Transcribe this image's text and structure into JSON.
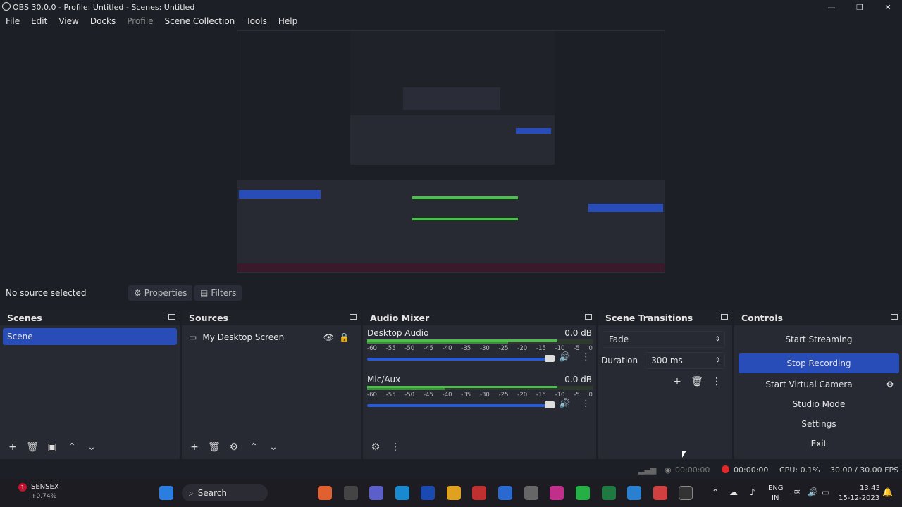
{
  "window": {
    "title": "OBS 30.0.0 - Profile: Untitled - Scenes: Untitled",
    "minimize": "—",
    "maximize": "❐",
    "close": "✕"
  },
  "menu": [
    "File",
    "Edit",
    "View",
    "Docks",
    "Profile",
    "Scene Collection",
    "Tools",
    "Help"
  ],
  "source_bar": {
    "no_source": "No source selected",
    "properties": "Properties",
    "filters": "Filters"
  },
  "scenes": {
    "title": "Scenes",
    "items": [
      "Scene"
    ]
  },
  "sources": {
    "title": "Sources",
    "items": [
      "My Desktop Screen"
    ]
  },
  "mixer": {
    "title": "Audio Mixer",
    "channels": [
      {
        "name": "Desktop Audio",
        "db": "0.0 dB"
      },
      {
        "name": "Mic/Aux",
        "db": "0.0 dB"
      }
    ],
    "ticks": [
      "-60",
      "-55",
      "-50",
      "-45",
      "-40",
      "-35",
      "-30",
      "-25",
      "-20",
      "-15",
      "-10",
      "-5",
      "0"
    ]
  },
  "transitions": {
    "title": "Scene Transitions",
    "selected": "Fade",
    "duration_label": "Duration",
    "duration_value": "300 ms"
  },
  "controls": {
    "title": "Controls",
    "start_streaming": "Start Streaming",
    "stop_recording": "Stop Recording",
    "start_virtual_camera": "Start Virtual Camera",
    "studio_mode": "Studio Mode",
    "settings": "Settings",
    "exit": "Exit"
  },
  "status": {
    "stream_time": "00:00:00",
    "rec_time": "00:00:00",
    "cpu": "CPU: 0.1%",
    "fps": "30.00 / 30.00 FPS"
  },
  "taskbar": {
    "widget_name": "SENSEX",
    "widget_change": "+0.74%",
    "widget_badge": "1",
    "search": "Search",
    "lang1": "ENG",
    "lang2": "IN",
    "time": "13:43",
    "date": "15-12-2023"
  },
  "colors": {
    "accent": "#284cb8",
    "panel": "#272a33",
    "bg": "#1d1f26",
    "rec": "#e02828"
  }
}
